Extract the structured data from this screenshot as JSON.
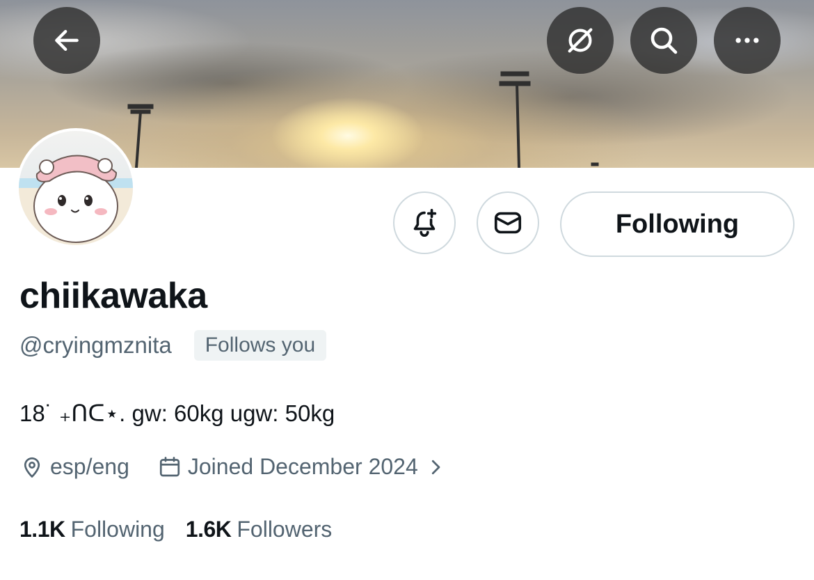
{
  "header": {
    "back_icon": "arrow-left-icon",
    "grok_icon": "grok-icon",
    "search_icon": "search-icon",
    "more_icon": "more-horizontal-icon"
  },
  "profile": {
    "display_name": "chiikawaka",
    "handle": "@cryingmznita",
    "follows_you_badge": "Follows you",
    "bio": "18˙ ₊ᑎᑕ⋆. gw: 60kg ugw: 50kg",
    "location": "esp/eng",
    "joined": "Joined December 2024",
    "following_count": "1.1K",
    "following_label": "Following",
    "followers_count": "1.6K",
    "followers_label": "Followers"
  },
  "actions": {
    "notify_icon": "bell-plus-icon",
    "message_icon": "envelope-icon",
    "following_button": "Following"
  },
  "colors": {
    "text_primary": "#0f1419",
    "text_secondary": "#536471",
    "border": "#cfd9de",
    "badge_bg": "#eff3f4"
  }
}
